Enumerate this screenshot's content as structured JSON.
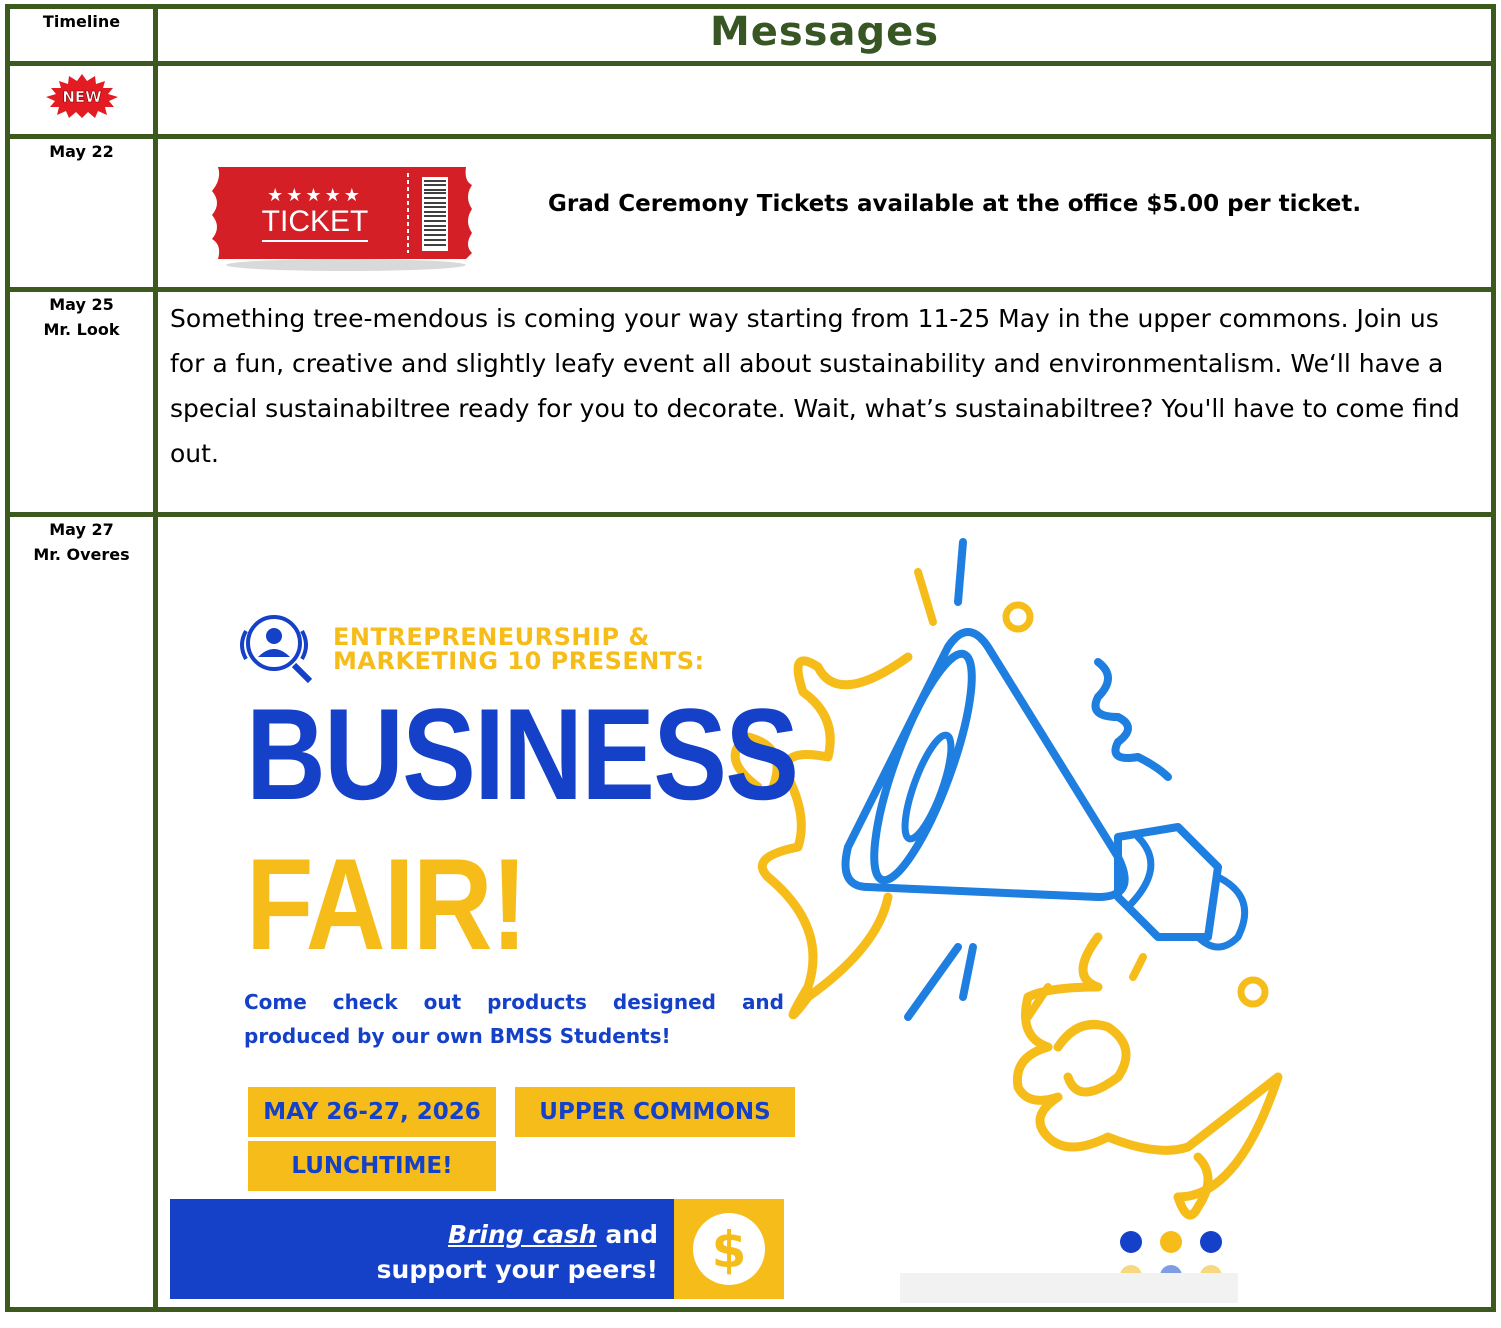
{
  "header": {
    "timeline_label": "Timeline",
    "messages_title": "Messages"
  },
  "badge": {
    "new_label": "NEW",
    "color": "#e31b23"
  },
  "rows": [
    {
      "date": "May 22",
      "author": "",
      "ticket_word": "TICKET",
      "ticket_stars": "★★★★★",
      "message": "Grad Ceremony Tickets available at the office $5.00 per ticket."
    },
    {
      "date": "May 25",
      "author": "Mr. Look",
      "message": "Something tree-mendous is coming your way starting from 11-25 May in the upper commons. Join us for a fun, creative and slightly leafy event all about sustainability and environmentalism. We‘ll have a special sustainabiltree ready for you to decorate. Wait, what’s sustainabiltree? You'll have to come find out."
    },
    {
      "date": "May 27",
      "author": "Mr. Overes"
    }
  ],
  "poster": {
    "presents_line1": "ENTREPRENEURSHIP &",
    "presents_line2": "MARKETING 10 PRESENTS:",
    "title_line1": "BUSINESS",
    "title_line2": "FAIR!",
    "description": "Come check out products designed and produced by our own BMSS Students!",
    "date_tag": "MAY 26-27, 2026",
    "place_tag": "UPPER COMMONS",
    "time_tag": "LUNCHTIME!",
    "cash_emphasis": "Bring cash",
    "cash_line1_rest": " and",
    "cash_line2": "support your peers!",
    "dollar": "$",
    "colors": {
      "blue": "#1540c8",
      "yellow": "#f6bd1a",
      "megaphone": "#1e7fe0"
    }
  },
  "colors": {
    "border": "#3d5a1e",
    "title": "#375623"
  }
}
